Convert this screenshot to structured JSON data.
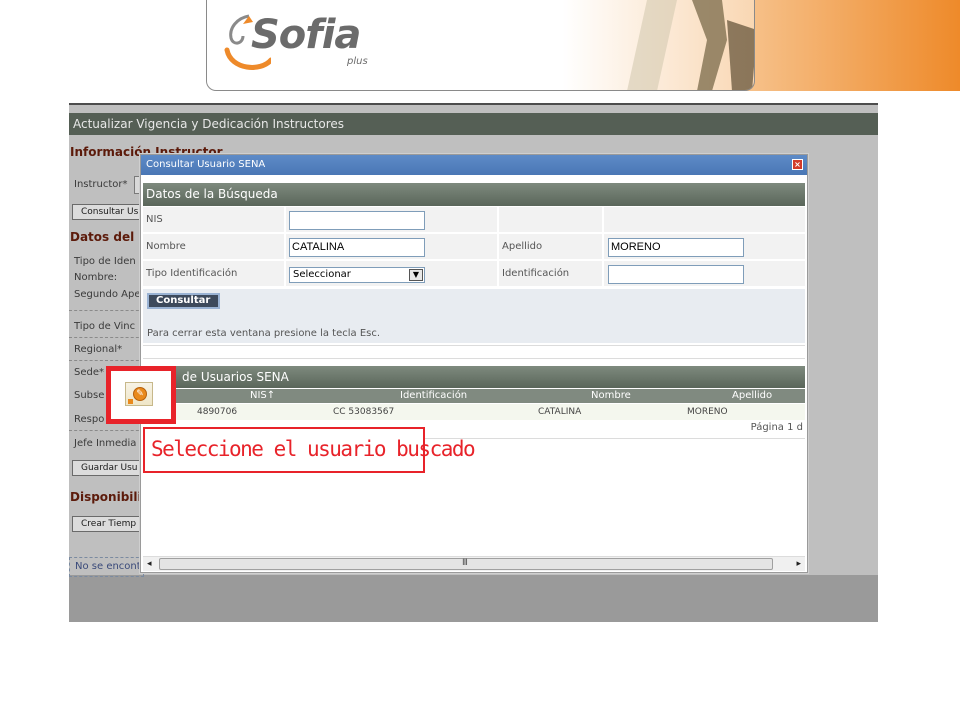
{
  "banner": {
    "logo_text": "Sofia",
    "logo_sub": "plus"
  },
  "app": {
    "title": "Actualizar Vigencia y Dedicación Instructores",
    "section_info": "Información Instructor",
    "instructor_label": "Instructor*",
    "consultar_button": "Consultar Us",
    "section_datos": "Datos del Ir",
    "tipo_ident": "Tipo de Iden",
    "nombre": "Nombre:",
    "segundo_ape": "Segundo Ape",
    "tipo_vinc": "Tipo de Vinc",
    "regional": "Regional*",
    "sede": "Sede*",
    "subse": "Subse",
    "respo": "Respo",
    "jefe": "Jefe Inmedia",
    "guardar_button": "Guardar Usu",
    "section_disp": "Disponibilid",
    "crear_button": "Crear Tiemp",
    "no_found": "No se encont"
  },
  "modal": {
    "title": "Consultar Usuario SENA",
    "close_glyph": "×",
    "search_header": "Datos de la Búsqueda",
    "fields": {
      "nis_label": "NIS",
      "nis_value": "",
      "nombre_label": "Nombre",
      "nombre_value": "CATALINA",
      "apellido_label": "Apellido",
      "apellido_value": "MORENO",
      "tipo_ident_label": "Tipo Identificación",
      "tipo_ident_value": "Seleccionar",
      "identificacion_label": "Identificación",
      "identificacion_value": ""
    },
    "consultar_button": "Consultar",
    "close_hint": "Para cerrar esta ventana presione la tecla Esc.",
    "results_header": "de Usuarios SENA",
    "columns": [
      "NIS↑",
      "Identificación",
      "Nombre",
      "Apellido"
    ],
    "rows": [
      {
        "nis": "4890706",
        "identificacion": "CC 53083567",
        "nombre": "CATALINA",
        "apellido": "MORENO"
      }
    ],
    "pager": "Página 1 d",
    "scroll_grip": "III"
  },
  "callout": {
    "label": "Seleccione el usuario buscado",
    "icon": "select-pencil-icon"
  },
  "colors": {
    "accent_orange": "#ee8a2a",
    "callout_red": "#e8232a",
    "titlebar_blue": "#4a77b5",
    "section_green": "#5a665a"
  }
}
